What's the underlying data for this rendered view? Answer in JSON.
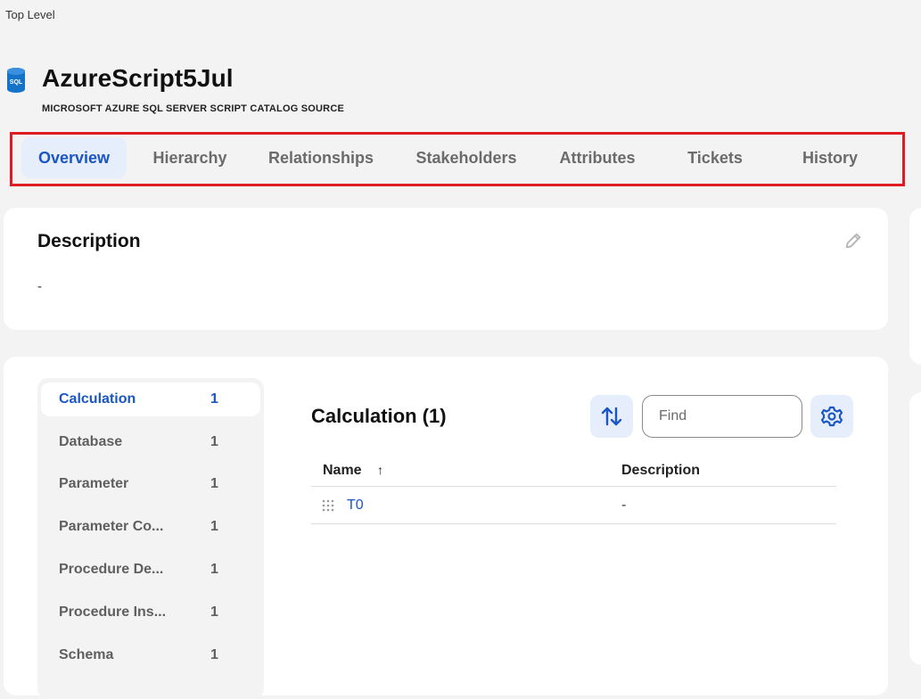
{
  "breadcrumb": "Top Level",
  "asset": {
    "icon": "sql-database-icon",
    "icon_text": "SQL",
    "title": "AzureScript5Jul",
    "subtitle": "MICROSOFT AZURE SQL SERVER SCRIPT CATALOG SOURCE"
  },
  "tabs": [
    {
      "label": "Overview",
      "active": true
    },
    {
      "label": "Hierarchy"
    },
    {
      "label": "Relationships"
    },
    {
      "label": "Stakeholders"
    },
    {
      "label": "Attributes"
    },
    {
      "label": "Tickets"
    },
    {
      "label": "History"
    }
  ],
  "description": {
    "title": "Description",
    "value": "-",
    "edit_icon": "pencil-icon"
  },
  "object_types": [
    {
      "label": "Calculation",
      "count": "1",
      "active": true
    },
    {
      "label": "Database",
      "count": "1"
    },
    {
      "label": "Parameter",
      "count": "1"
    },
    {
      "label": "Parameter Co...",
      "count": "1"
    },
    {
      "label": "Procedure De...",
      "count": "1"
    },
    {
      "label": "Procedure Ins...",
      "count": "1"
    },
    {
      "label": "Schema",
      "count": "1"
    }
  ],
  "list": {
    "title": "Calculation (1)",
    "sort_icon": "sort-arrows-icon",
    "find_placeholder": "Find",
    "settings_icon": "gear-icon",
    "columns": {
      "name": "Name",
      "description": "Description",
      "name_sort": "↑"
    },
    "rows": [
      {
        "name": "T0",
        "description": "-"
      }
    ]
  },
  "colors": {
    "accent": "#1a56c4",
    "accent_bg": "#e6edfb",
    "highlight_border": "#e01b24",
    "background": "#f3f3f3"
  }
}
